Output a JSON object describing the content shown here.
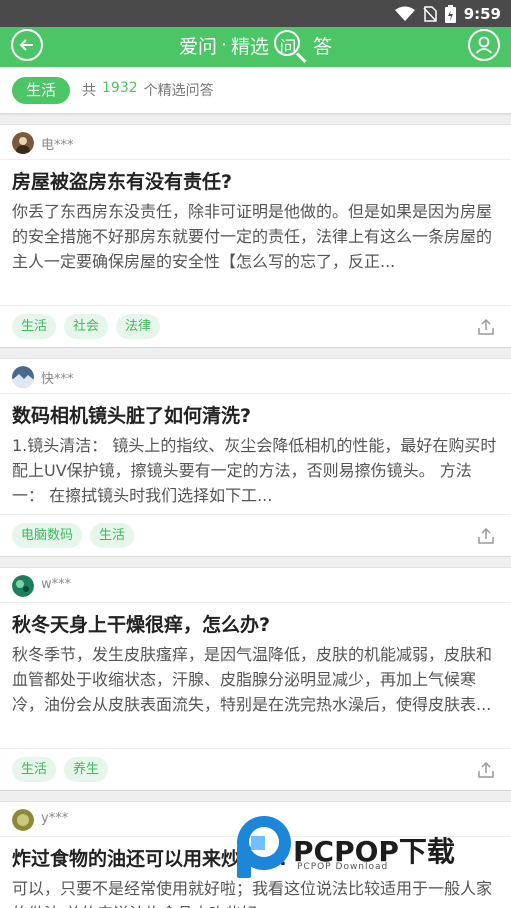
{
  "status_bar": {
    "time": "9:59",
    "icons": [
      "wifi-icon",
      "no-sim-icon",
      "battery-charging-icon"
    ]
  },
  "app_bar": {
    "title_main": "爱问",
    "title_sep": "·",
    "title_sub": "精选",
    "title_ask": "问",
    "title_answer": "答",
    "icons": [
      "back-arrow-icon",
      "search-magnifier-icon",
      "user-icon"
    ],
    "accent_color": "#4cc567"
  },
  "filter": {
    "category": "生活",
    "count_prefix": "共",
    "count": "1932",
    "count_suffix": "个精选问答"
  },
  "questions": [
    {
      "user": "电***",
      "title": "房屋被盗房东有没有责任?",
      "body": "你丢了东西房东没责任，除非可证明是他做的。但是如果是因为房屋的安全措施不好那房东就要付一定的责任，法律上有这么一条房屋的主人一定要确保房屋的安全性【怎么写的忘了，反正...",
      "tags": [
        "生活",
        "社会",
        "法律"
      ]
    },
    {
      "user": "快***",
      "title": "数码相机镜头脏了如何清洗?",
      "body": "1.镜头清洁： 镜头上的指纹、灰尘会降低相机的性能，最好在购买时配上UV保护镜，擦镜头要有一定的方法，否则易擦伤镜头。 方法一： 在擦拭镜头时我们选择如下工...",
      "tags": [
        "电脑数码",
        "生活"
      ]
    },
    {
      "user": "w***",
      "title": "秋冬天身上干燥很痒，怎么办?",
      "body": "秋冬季节，发生皮肤瘙痒，是因气温降低，皮肤的机能减弱，皮肤和血管都处于收缩状态，汗腺、皮脂腺分泌明显减少，再加上气候寒冷，油份会从皮肤表面流失，特别是在洗完热水澡后，使得皮肤表...",
      "tags": [
        "生活",
        "养生"
      ]
    },
    {
      "user": "y***",
      "title": "炸过食物的油还可以用来炒菜吗?",
      "body": "可以，只要不是经常使用就好啦；我看这位说法比较适用于一般人家的做法,总的来说油炸食品少吃些好",
      "tags": []
    }
  ],
  "watermark": {
    "brand": "PCPOP下载",
    "sub": "PCPOP Download"
  }
}
